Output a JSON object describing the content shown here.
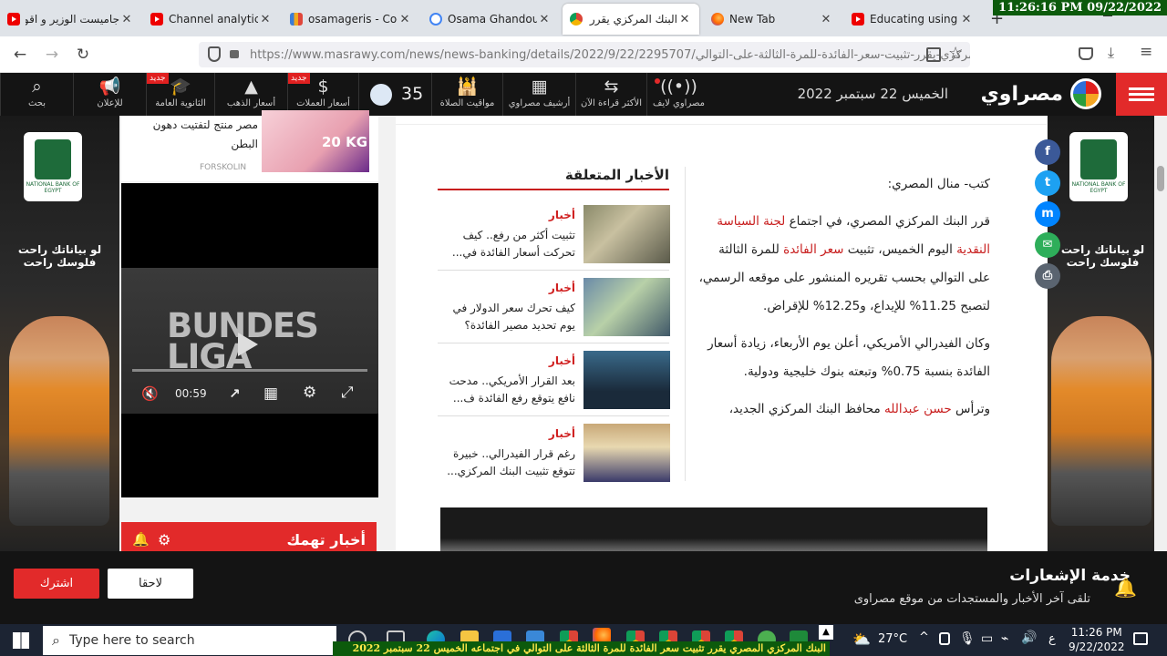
{
  "clock": "11:26:16 PM 09/22/2022",
  "tabs": [
    {
      "title": "جاميست الوزير و اقوى",
      "icon": "youtube-icon"
    },
    {
      "title": "Channel analytics - ",
      "icon": "youtube-icon"
    },
    {
      "title": "osamageris - Codef",
      "icon": "codeforces-icon"
    },
    {
      "title": "Osama Ghandour G",
      "icon": "google-icon"
    },
    {
      "title": "البنك المركزي يقرر تث",
      "icon": "chrome-icon"
    },
    {
      "title": "New Tab",
      "icon": "firefox-icon"
    },
    {
      "title": "Educating using tec",
      "icon": "youtube-icon"
    }
  ],
  "new_tab_label": "+",
  "url": "https://www.masrawy.com/news/news-banking/details/2022/9/22/2295707/البنك-المركزي-يقرر-تثبيت-سعر-الفائدة-للمرة-الثالثة-على-التوالي",
  "url_display": "https://www.masrawy.com/news/news-banking/details/2022/9/22/2295707/البنك-المركزي-يقرر-تثبيت-سعر-الفائدة-للمرة-الثالثة-على-التوالي/",
  "header": {
    "logo": "مصراوي",
    "date": "الخميس 22 سبتمبر 2022",
    "live": "مصراوي لايف",
    "most_read": "الأكثر قراءة الآن",
    "archive": "أرشيف مصراوي",
    "prayer": "مواقيت الصلاة",
    "temp": "35",
    "currency": "أسعار العملات",
    "gold": "أسعار الذهب",
    "thanaweya": "الثانوية العامة",
    "ads": "للإعلان",
    "search": "بحث",
    "badge_new": "جديد"
  },
  "side_ad": {
    "bank": "البنك الأهلي المصري",
    "bank_en": "NATIONAL BANK OF EGYPT",
    "slogan": "لو بياناتك راحت فلوسك راحت"
  },
  "sponsored": {
    "headline": "مصر منتج لتفتيت دهون البطن",
    "source": "FORSKOLIN",
    "img_text": "20 KG"
  },
  "video": {
    "brand_line1": "BUNDES",
    "brand_line2": "LIGA",
    "time": "00:59"
  },
  "hot_news": "أخبار تهمك",
  "related": {
    "title": "الأخبار المتعلقة",
    "items": [
      {
        "cat": "أخبار",
        "headline": "تثبيت أكثر من رفع.. كيف تحركت أسعار الفائدة في..."
      },
      {
        "cat": "أخبار",
        "headline": "كيف تحرك سعر الدولار في يوم تحديد مصير الفائدة؟"
      },
      {
        "cat": "أخبار",
        "headline": "بعد القرار الأمريكي.. مدحت نافع يتوقع رفع الفائدة ف..."
      },
      {
        "cat": "أخبار",
        "headline": "رغم قرار الفيدرالي.. خبيرة تتوقع تثبيت البنك المركزي..."
      }
    ]
  },
  "article": {
    "byline": "كتب- منال المصري:",
    "p1_a": "قرر البنك المركزي المصري، في اجتماع ",
    "p1_link1": "لجنة السياسة النقدية",
    "p1_b": " اليوم الخميس، تثبيت ",
    "p1_link2": "سعر الفائدة",
    "p1_c": " للمرة الثالثة على التوالي بحسب تقريره المنشور على موقعه الرسمي، لتصبح 11.25% للإيداع، و12.25% للإقراض.",
    "p2": "وكان الفيدرالي الأمريكي، أعلن يوم الأربعاء، زيادة أسعار الفائدة بنسبة 0.75% وتبعته بنوك خليجية ودولية.",
    "p3_a": "وترأس ",
    "p3_link": "حسن عبدالله",
    "p3_b": " محافظ البنك المركزي الجديد،"
  },
  "notification": {
    "title": "خدمة الإشعارات",
    "subtitle": "تلقى آخر الأخبار والمستجدات من موقع مصراوى",
    "subscribe": "اشترك",
    "later": "لاحقا"
  },
  "taskbar": {
    "search_placeholder": "Type here to search",
    "weather": "27°C",
    "time": "11:26 PM",
    "date": "9/22/2022",
    "lang": "ع"
  },
  "ticker": "البنك المركزي المصري يقرر تثبيت سعر الفائدة للمرة الثالثة على التوالي في اجتماعه الخميس 22 سبتمبر 2022",
  "colors": {
    "brand_red": "#e22a2a",
    "header_bg": "#141414",
    "link_red": "#c81e1e",
    "ticker_green": "#0c5a0c"
  }
}
